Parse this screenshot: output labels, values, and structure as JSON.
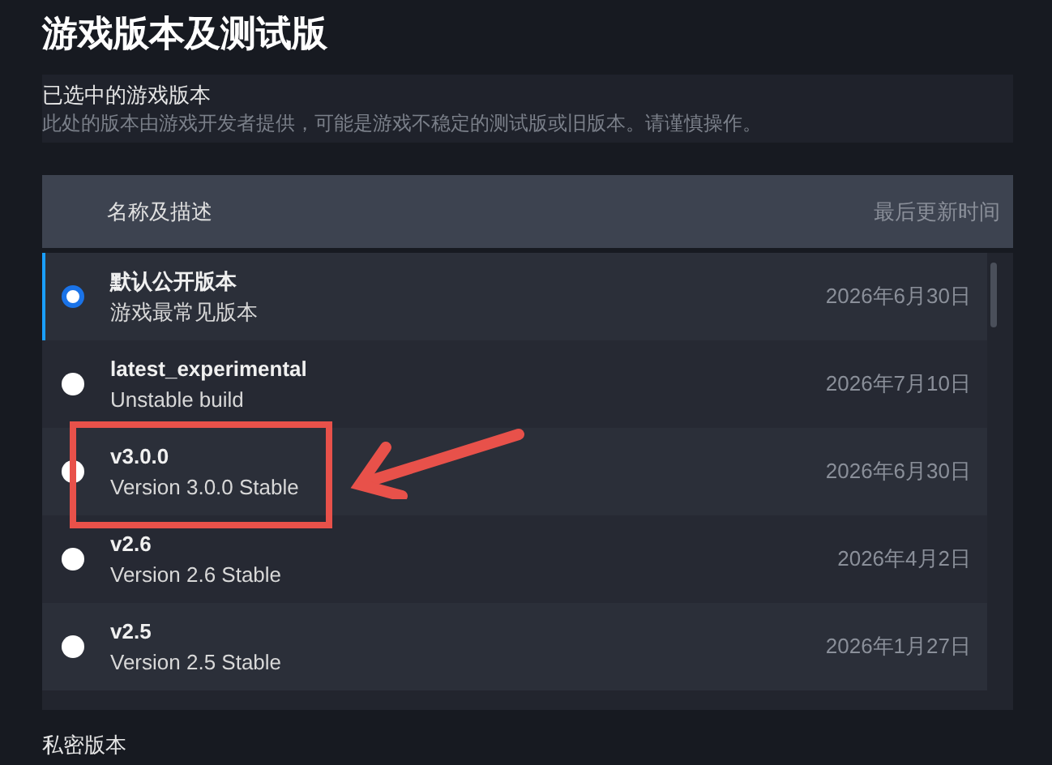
{
  "title": "游戏版本及测试版",
  "selected_section": {
    "heading": "已选中的游戏版本",
    "description": "此处的版本由游戏开发者提供，可能是游戏不稳定的测试版或旧版本。请谨慎操作。"
  },
  "table": {
    "columns": [
      "名称及描述",
      "最后更新时间"
    ],
    "rows": [
      {
        "name": "默认公开版本",
        "description": "游戏最常见版本",
        "updated": "2026年6月30日",
        "selected": true,
        "highlighted": false
      },
      {
        "name": "latest_experimental",
        "description": "Unstable build",
        "updated": "2026年7月10日",
        "selected": false,
        "highlighted": false
      },
      {
        "name": "v3.0.0",
        "description": "Version 3.0.0 Stable",
        "updated": "2026年6月30日",
        "selected": false,
        "highlighted": true
      },
      {
        "name": "v2.6",
        "description": "Version 2.6 Stable",
        "updated": "2026年4月2日",
        "selected": false,
        "highlighted": false
      },
      {
        "name": "v2.5",
        "description": "Version 2.5 Stable",
        "updated": "2026年1月27日",
        "selected": false,
        "highlighted": false
      }
    ]
  },
  "private_section": {
    "heading": "私密版本"
  }
}
